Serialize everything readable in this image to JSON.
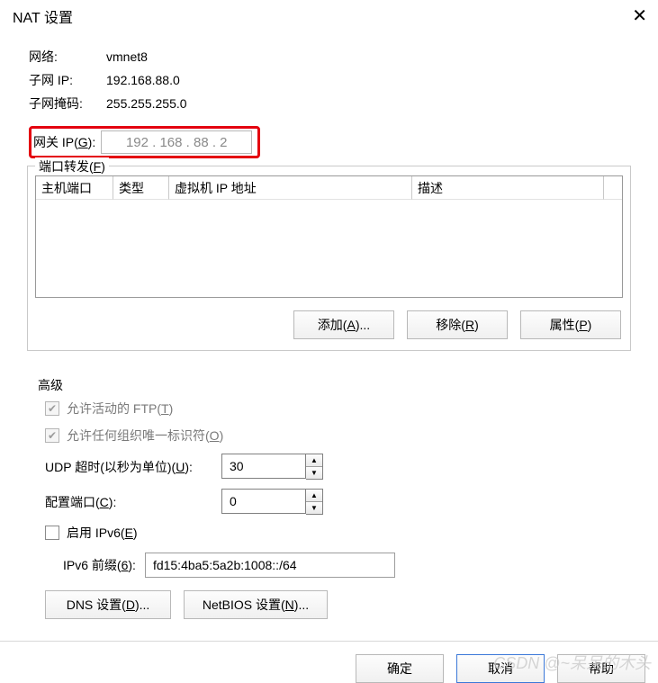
{
  "title": "NAT 设置",
  "info": {
    "network_label": "网络:",
    "network_value": "vmnet8",
    "subnetip_label": "子网 IP:",
    "subnetip_value": "192.168.88.0",
    "subnetmask_label": "子网掩码:",
    "subnetmask_value": "255.255.255.0"
  },
  "gateway": {
    "label_prefix": "网关 IP(",
    "label_u": "G",
    "label_suffix": "):",
    "value": "192 . 168 .  88  .   2"
  },
  "pf": {
    "legend_prefix": "端口转发(",
    "legend_u": "F",
    "legend_suffix": ")",
    "th_hostport": "主机端口",
    "th_type": "类型",
    "th_vmip": "虚拟机 IP 地址",
    "th_desc": "描述",
    "add_prefix": "添加(",
    "add_u": "A",
    "add_suffix": ")...",
    "remove_prefix": "移除(",
    "remove_u": "R",
    "remove_suffix": ")",
    "props_prefix": "属性(",
    "props_u": "P",
    "props_suffix": ")"
  },
  "adv": {
    "legend": "高级",
    "ftp_prefix": "允许活动的 FTP(",
    "ftp_u": "T",
    "ftp_suffix": ")",
    "uid_prefix": "允许任何组织唯一标识符(",
    "uid_u": "O",
    "uid_suffix": ")",
    "udp_prefix": "UDP 超时(以秒为单位)(",
    "udp_u": "U",
    "udp_suffix": "):",
    "udp_value": "30",
    "cfg_prefix": "配置端口(",
    "cfg_u": "C",
    "cfg_suffix": "):",
    "cfg_value": "0",
    "ip6_prefix": "启用 IPv6(",
    "ip6_u": "E",
    "ip6_suffix": ")",
    "ip6p_prefix": "IPv6 前缀(",
    "ip6p_u": "6",
    "ip6p_suffix": "):",
    "ip6p_value": "fd15:4ba5:5a2b:1008::/64",
    "dns_prefix": "DNS 设置(",
    "dns_u": "D",
    "dns_suffix": ")...",
    "nb_prefix": "NetBIOS 设置(",
    "nb_u": "N",
    "nb_suffix": ")..."
  },
  "footer": {
    "ok": "确定",
    "cancel": "取消",
    "help": "帮助"
  },
  "watermark": "CSDN @~呆呆的木头"
}
